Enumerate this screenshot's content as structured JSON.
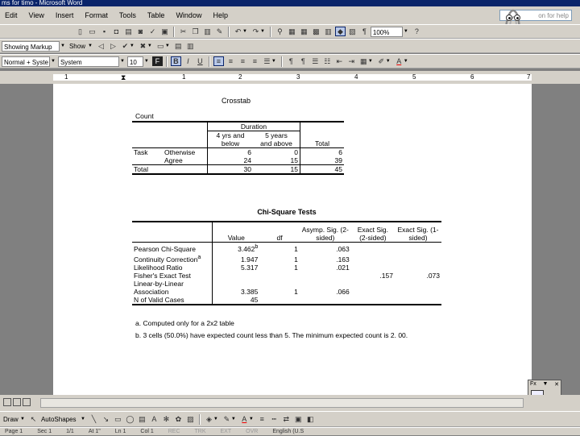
{
  "window": {
    "title": "ms  for timo - Microsoft Word"
  },
  "menu": [
    "Edit",
    "View",
    "Insert",
    "Format",
    "Tools",
    "Table",
    "Window",
    "Help"
  ],
  "help_box": {
    "text": "on for help"
  },
  "toolbar2": {
    "markup": "Showing Markup",
    "show": "Show",
    "zoom": "100%"
  },
  "toolbar3": {
    "style": "Normal + Syste",
    "font": "System",
    "size": "10"
  },
  "ruler": {
    "marks": [
      "1",
      "1",
      "2",
      "3",
      "4",
      "5",
      "6",
      "7"
    ]
  },
  "crosstab": {
    "title": "Crosstab",
    "count_label": "Count",
    "col_group": "Duration",
    "col1": [
      "4 yrs  and",
      "below"
    ],
    "col2": [
      "5 years",
      "and above"
    ],
    "total_header": "Total",
    "row_group": "Task",
    "rows": [
      {
        "label": "Otherwise",
        "values": [
          "6",
          "0",
          "6"
        ]
      },
      {
        "label": "Agree",
        "values": [
          "24",
          "15",
          "39"
        ]
      }
    ],
    "total_row": {
      "label": "Total",
      "values": [
        "30",
        "15",
        "45"
      ]
    }
  },
  "chisq": {
    "title": "Chi-Square Tests",
    "headers": [
      "Value",
      "df",
      "Asymp. Sig. (2-sided)",
      "Exact Sig. (2-sided)",
      "Exact Sig. (1-sided)"
    ],
    "rows": [
      {
        "label": "Pearson Chi-Square",
        "value": "3.462",
        "sup": "b",
        "df": "1",
        "asymp": ".063",
        "exact2": "",
        "exact1": ""
      },
      {
        "label": "Continuity Correction",
        "sup_label": "a",
        "value": "1.947",
        "df": "1",
        "asymp": ".163",
        "exact2": "",
        "exact1": ""
      },
      {
        "label": "Likelihood Ratio",
        "value": "5.317",
        "df": "1",
        "asymp": ".021",
        "exact2": "",
        "exact1": ""
      },
      {
        "label": "Fisher's Exact Test",
        "value": "",
        "df": "",
        "asymp": "",
        "exact2": ".157",
        "exact1": ".073"
      },
      {
        "label": "Linear-by-Linear Association",
        "value": "3.385",
        "df": "1",
        "asymp": ".066",
        "exact2": "",
        "exact1": ""
      },
      {
        "label": "N of Valid Cases",
        "value": "45",
        "df": "",
        "asymp": "",
        "exact2": "",
        "exact1": ""
      }
    ]
  },
  "notes": {
    "a": "a. Computed only for a 2x2 table",
    "b": "b. 3 cells (50.0%) have expected count less than 5. The minimum expected count is 2. 00."
  },
  "drawbar": {
    "draw": "Draw",
    "autoshapes": "AutoShapes"
  },
  "status": [
    "Page 1",
    "Sec 1",
    "1/1",
    "At 1\"",
    "Ln 1",
    "Col 1",
    "REC",
    "TRK",
    "EXT",
    "OVR",
    "English (U.S"
  ],
  "colors": {
    "menubar": "#d4d0c8",
    "title": "#0a246a",
    "page": "#ffffff",
    "desk": "#808080"
  }
}
